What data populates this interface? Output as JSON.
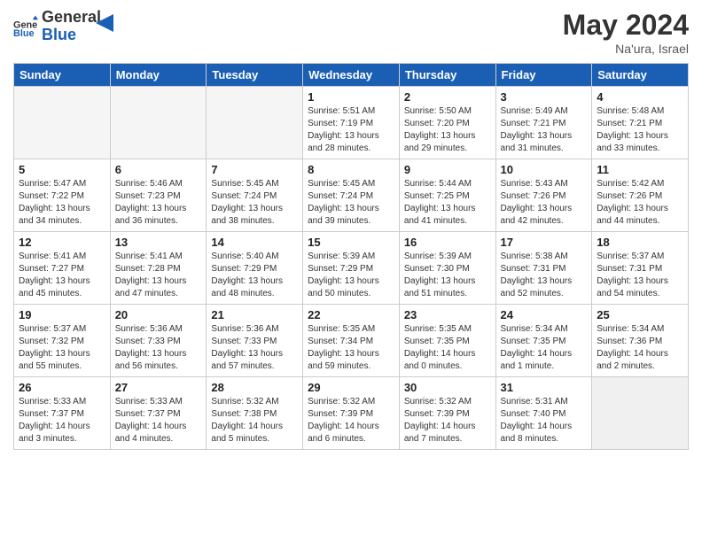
{
  "header": {
    "logo_line1": "General",
    "logo_line2": "Blue",
    "month_year": "May 2024",
    "location": "Na'ura, Israel"
  },
  "weekdays": [
    "Sunday",
    "Monday",
    "Tuesday",
    "Wednesday",
    "Thursday",
    "Friday",
    "Saturday"
  ],
  "weeks": [
    [
      {
        "day": "",
        "info": ""
      },
      {
        "day": "",
        "info": ""
      },
      {
        "day": "",
        "info": ""
      },
      {
        "day": "1",
        "info": "Sunrise: 5:51 AM\nSunset: 7:19 PM\nDaylight: 13 hours\nand 28 minutes."
      },
      {
        "day": "2",
        "info": "Sunrise: 5:50 AM\nSunset: 7:20 PM\nDaylight: 13 hours\nand 29 minutes."
      },
      {
        "day": "3",
        "info": "Sunrise: 5:49 AM\nSunset: 7:21 PM\nDaylight: 13 hours\nand 31 minutes."
      },
      {
        "day": "4",
        "info": "Sunrise: 5:48 AM\nSunset: 7:21 PM\nDaylight: 13 hours\nand 33 minutes."
      }
    ],
    [
      {
        "day": "5",
        "info": "Sunrise: 5:47 AM\nSunset: 7:22 PM\nDaylight: 13 hours\nand 34 minutes."
      },
      {
        "day": "6",
        "info": "Sunrise: 5:46 AM\nSunset: 7:23 PM\nDaylight: 13 hours\nand 36 minutes."
      },
      {
        "day": "7",
        "info": "Sunrise: 5:45 AM\nSunset: 7:24 PM\nDaylight: 13 hours\nand 38 minutes."
      },
      {
        "day": "8",
        "info": "Sunrise: 5:45 AM\nSunset: 7:24 PM\nDaylight: 13 hours\nand 39 minutes."
      },
      {
        "day": "9",
        "info": "Sunrise: 5:44 AM\nSunset: 7:25 PM\nDaylight: 13 hours\nand 41 minutes."
      },
      {
        "day": "10",
        "info": "Sunrise: 5:43 AM\nSunset: 7:26 PM\nDaylight: 13 hours\nand 42 minutes."
      },
      {
        "day": "11",
        "info": "Sunrise: 5:42 AM\nSunset: 7:26 PM\nDaylight: 13 hours\nand 44 minutes."
      }
    ],
    [
      {
        "day": "12",
        "info": "Sunrise: 5:41 AM\nSunset: 7:27 PM\nDaylight: 13 hours\nand 45 minutes."
      },
      {
        "day": "13",
        "info": "Sunrise: 5:41 AM\nSunset: 7:28 PM\nDaylight: 13 hours\nand 47 minutes."
      },
      {
        "day": "14",
        "info": "Sunrise: 5:40 AM\nSunset: 7:29 PM\nDaylight: 13 hours\nand 48 minutes."
      },
      {
        "day": "15",
        "info": "Sunrise: 5:39 AM\nSunset: 7:29 PM\nDaylight: 13 hours\nand 50 minutes."
      },
      {
        "day": "16",
        "info": "Sunrise: 5:39 AM\nSunset: 7:30 PM\nDaylight: 13 hours\nand 51 minutes."
      },
      {
        "day": "17",
        "info": "Sunrise: 5:38 AM\nSunset: 7:31 PM\nDaylight: 13 hours\nand 52 minutes."
      },
      {
        "day": "18",
        "info": "Sunrise: 5:37 AM\nSunset: 7:31 PM\nDaylight: 13 hours\nand 54 minutes."
      }
    ],
    [
      {
        "day": "19",
        "info": "Sunrise: 5:37 AM\nSunset: 7:32 PM\nDaylight: 13 hours\nand 55 minutes."
      },
      {
        "day": "20",
        "info": "Sunrise: 5:36 AM\nSunset: 7:33 PM\nDaylight: 13 hours\nand 56 minutes."
      },
      {
        "day": "21",
        "info": "Sunrise: 5:36 AM\nSunset: 7:33 PM\nDaylight: 13 hours\nand 57 minutes."
      },
      {
        "day": "22",
        "info": "Sunrise: 5:35 AM\nSunset: 7:34 PM\nDaylight: 13 hours\nand 59 minutes."
      },
      {
        "day": "23",
        "info": "Sunrise: 5:35 AM\nSunset: 7:35 PM\nDaylight: 14 hours\nand 0 minutes."
      },
      {
        "day": "24",
        "info": "Sunrise: 5:34 AM\nSunset: 7:35 PM\nDaylight: 14 hours\nand 1 minute."
      },
      {
        "day": "25",
        "info": "Sunrise: 5:34 AM\nSunset: 7:36 PM\nDaylight: 14 hours\nand 2 minutes."
      }
    ],
    [
      {
        "day": "26",
        "info": "Sunrise: 5:33 AM\nSunset: 7:37 PM\nDaylight: 14 hours\nand 3 minutes."
      },
      {
        "day": "27",
        "info": "Sunrise: 5:33 AM\nSunset: 7:37 PM\nDaylight: 14 hours\nand 4 minutes."
      },
      {
        "day": "28",
        "info": "Sunrise: 5:32 AM\nSunset: 7:38 PM\nDaylight: 14 hours\nand 5 minutes."
      },
      {
        "day": "29",
        "info": "Sunrise: 5:32 AM\nSunset: 7:39 PM\nDaylight: 14 hours\nand 6 minutes."
      },
      {
        "day": "30",
        "info": "Sunrise: 5:32 AM\nSunset: 7:39 PM\nDaylight: 14 hours\nand 7 minutes."
      },
      {
        "day": "31",
        "info": "Sunrise: 5:31 AM\nSunset: 7:40 PM\nDaylight: 14 hours\nand 8 minutes."
      },
      {
        "day": "",
        "info": ""
      }
    ]
  ]
}
